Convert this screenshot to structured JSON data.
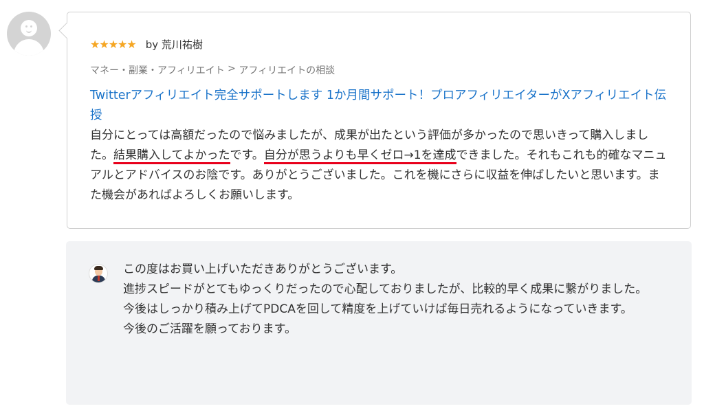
{
  "review": {
    "stars": "★★★★★",
    "author": "by 荒川祐樹",
    "category": "マネー・副業・アフィリエイト",
    "category_sep": " > ",
    "subcategory": "アフィリエイトの相談",
    "service_title": "Twitterアフィリエイト完全サポートします 1か月間サポート！プロアフィリエイターがXアフィリエイト伝授",
    "body_part1": "自分にとっては高額だったので悩みましたが、成果が出たという評価が多かったので思いきって購入しました。",
    "body_highlight1": "結果購入してよかった",
    "body_part2": "です。",
    "body_highlight2": "自分が思うよりも早くゼロ→1を達成",
    "body_part3": "できました。それもこれも的確なマニュアルとアドバイスのお陰です。ありがとうございました。これを機にさらに収益を伸ばしたいと思います。また機会があればよろしくお願いします。",
    "highlight_color": "#e8001b",
    "star_color": "#f5a623",
    "link_color": "#1a73c9"
  },
  "reply": {
    "lines": [
      "この度はお買い上げいただきありがとうございます。",
      "進捗スピードがとてもゆっくりだったので心配しておりましたが、比較的早く成果に繋がりました。",
      "今後はしっかり積み上げてPDCAを回して精度を上げていけば毎日売れるようになっていきます。",
      "今後のご活躍を願っております。"
    ]
  }
}
